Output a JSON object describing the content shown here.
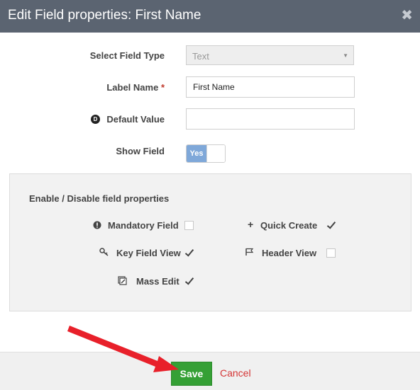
{
  "dialog": {
    "title": "Edit Field properties: First Name",
    "close_symbol": "✖"
  },
  "form": {
    "field_type_label": "Select Field Type",
    "field_type_value": "Text",
    "label_name_label": "Label Name",
    "required_marker": "*",
    "label_name_value": "First Name",
    "default_value_icon": "D",
    "default_value_label": "Default Value",
    "default_value_value": "",
    "show_field_label": "Show Field",
    "show_field_toggle": "Yes"
  },
  "properties": {
    "title": "Enable / Disable field properties",
    "items": [
      {
        "label": "Mandatory Field",
        "icon": "exclamation-circle-icon",
        "checked": false
      },
      {
        "label": "Quick Create",
        "icon": "plus-icon",
        "checked": true
      },
      {
        "label": "Key Field View",
        "icon": "key-icon",
        "checked": true
      },
      {
        "label": "Header View",
        "icon": "flag-icon",
        "checked": false
      },
      {
        "label": "Mass Edit",
        "icon": "mass-edit-icon",
        "checked": true
      }
    ]
  },
  "footer": {
    "save_label": "Save",
    "cancel_label": "Cancel"
  },
  "colors": {
    "header_bg": "#5b6471",
    "save_bg": "#35a035",
    "cancel_text": "#d43434",
    "toggle_on": "#7fa8d9",
    "arrow": "#e8202a"
  }
}
